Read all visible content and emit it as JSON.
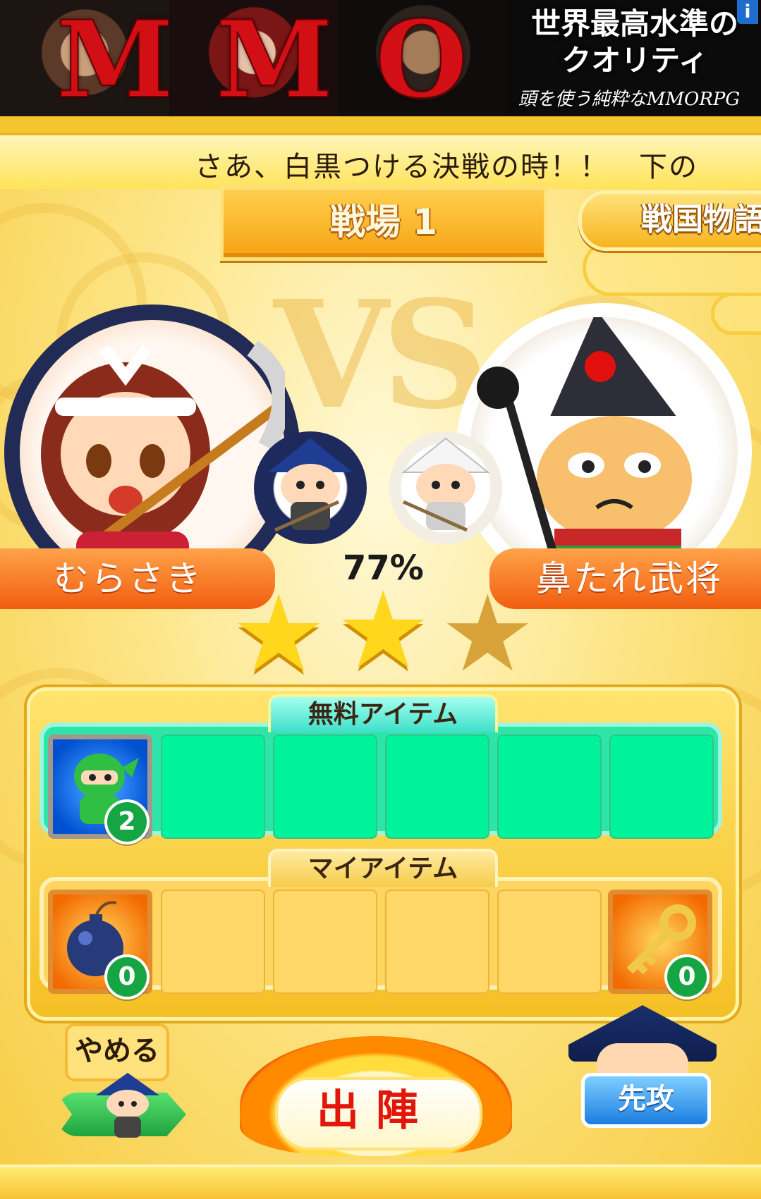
{
  "ad": {
    "brand": "MMO",
    "headline_line1": "世界最高水準の",
    "headline_line2": "クオリティ",
    "subline": "頭を使う純粋なMMORPG",
    "info": "i"
  },
  "ticker": {
    "text": "さあ、白黒つける決戦の時！！　下の"
  },
  "stage": {
    "title": "戦場 1"
  },
  "story_tab": {
    "label": "戦国物語"
  },
  "vs_text": "VS",
  "battle": {
    "player": {
      "name": "むらさき"
    },
    "opponent": {
      "name": "鼻たれ武将"
    },
    "win_rate": "77%",
    "stars_filled": 2,
    "stars_total": 3
  },
  "free_items": {
    "label": "無料アイテム",
    "slots": [
      {
        "icon": "ninja-icon",
        "count": "2"
      }
    ]
  },
  "my_items": {
    "label": "マイアイテム",
    "slots": [
      {
        "icon": "bomb-icon",
        "count": "0"
      },
      {
        "icon": "key-icon",
        "count": "0"
      }
    ]
  },
  "buttons": {
    "quit": "やめる",
    "sortie": "出陣",
    "first_attack": "先攻"
  }
}
